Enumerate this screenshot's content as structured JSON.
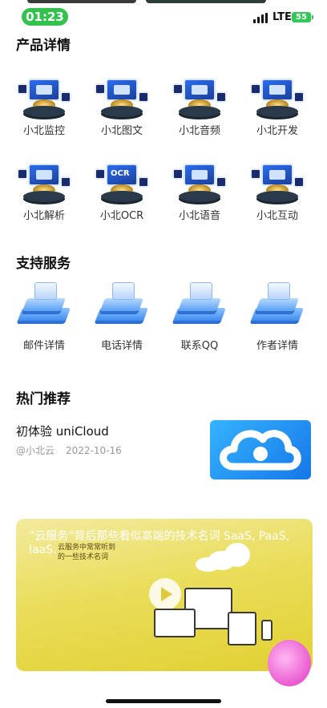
{
  "status_bar": {
    "time": "01:23",
    "network": "LTE",
    "battery": "55"
  },
  "products": {
    "title": "产品详情",
    "items": [
      {
        "label": "小北监控",
        "icon": "monitor-icon"
      },
      {
        "label": "小北图文",
        "icon": "image-text-icon"
      },
      {
        "label": "小北音频",
        "icon": "audio-icon"
      },
      {
        "label": "小北开发",
        "icon": "code-icon"
      },
      {
        "label": "小北解析",
        "icon": "video-parse-icon"
      },
      {
        "label": "小北OCR",
        "icon": "ocr-icon",
        "mark": "OCR"
      },
      {
        "label": "小北语音",
        "icon": "microphone-icon"
      },
      {
        "label": "小北互动",
        "icon": "interactive-icon"
      }
    ]
  },
  "services": {
    "title": "支持服务",
    "items": [
      {
        "label": "邮件详情",
        "icon": "mail-icon"
      },
      {
        "label": "电话详情",
        "icon": "phone-icon"
      },
      {
        "label": "联系QQ",
        "icon": "qq-icon"
      },
      {
        "label": "作者详情",
        "icon": "author-icon"
      }
    ]
  },
  "hot": {
    "title": "热门推荐",
    "article": {
      "title": "初体验 uniCloud",
      "author": "@小北云",
      "date": "2022-10-16"
    }
  },
  "banner": {
    "title": "“云服务”背后那些看似高端的技术名词 SaaS, PaaS, IaaS.",
    "sub_line1": "云服务中常常听到",
    "sub_line2": "的一些技术名词"
  },
  "colors": {
    "accent_green": "#32c24d",
    "banner_yellow": "#e8da4e",
    "thumb_blue": "#1677e8"
  }
}
